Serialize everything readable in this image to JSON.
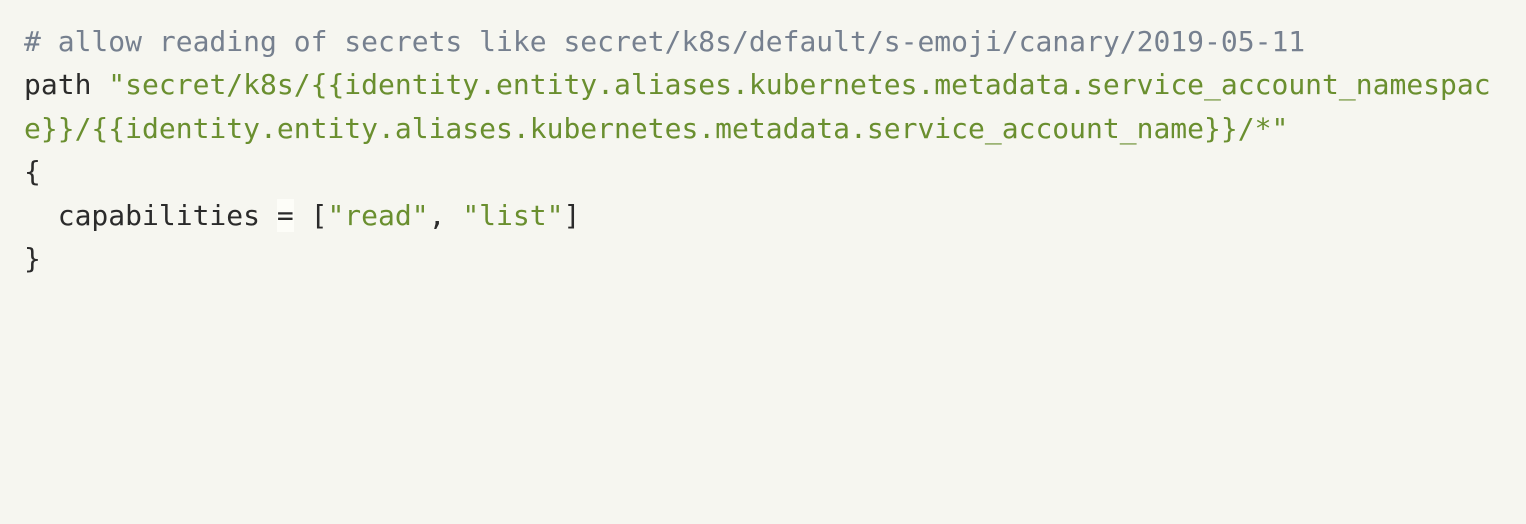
{
  "code": {
    "line1_comment": "# allow reading of secrets like secret/k8s/default/s-emoji/canary/2019-05-11",
    "line2_kw": "path",
    "line2_sp": " ",
    "line2_str": "\"secret/k8s/{{identity.entity.aliases.kubernetes.metadata.service_account_namespace}}/{{identity.entity.aliases.kubernetes.metadata.service_account_name}}/*\"",
    "line3_open": "{",
    "line4_indent": "  ",
    "line4_ident": "capabilities",
    "line4_sp1": " ",
    "line4_op": "=",
    "line4_sp2": " ",
    "line4_lb": "[",
    "line4_v1": "\"read\"",
    "line4_comma": ",",
    "line4_sp3": " ",
    "line4_v2": "\"list\"",
    "line4_rb": "]",
    "line5_close": "}"
  }
}
